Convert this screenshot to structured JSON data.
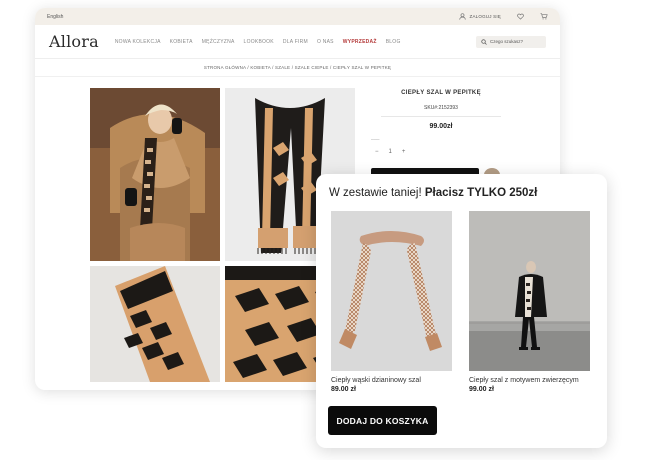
{
  "shop": {
    "topbar": {
      "language": "English",
      "login": "ZALOGUJ SIĘ"
    },
    "logo": "Allora",
    "nav": [
      {
        "label": "NOWA KOLEKCJA"
      },
      {
        "label": "KOBIETA"
      },
      {
        "label": "MĘŻCZYZNA"
      },
      {
        "label": "LOOKBOOK"
      },
      {
        "label": "DLA FIRM"
      },
      {
        "label": "O NAS"
      },
      {
        "label": "WYPRZEDAŻ"
      },
      {
        "label": "BLOG"
      }
    ],
    "search_placeholder": "Czego szukasz?",
    "breadcrumb": "STRONA GŁÓWNA / KOBIETA / SZALE / SZALE CIEPŁE / CIEPŁY SZAL W PEPITKĘ",
    "product": {
      "title": "CIEPŁY SZAL W PEPITKĘ",
      "sku": "SKU#:2152393",
      "price": "99.00zł",
      "quantity": "1",
      "minus": "−",
      "plus": "+"
    },
    "icons": {
      "user": "user-icon",
      "heart": "heart-icon",
      "cart": "cart-icon",
      "search": "search-icon"
    },
    "colors": {
      "sale": "#b43a3a",
      "topbar_bg": "#f3efe9",
      "accent_brown": "#b39d86"
    }
  },
  "bundle": {
    "title_prefix": "W zestawie taniej!",
    "title_bold": "Płacisz TYLKO 250zł",
    "items": [
      {
        "name": "Ciepły wąski dzianinowy szal",
        "price": "89.00 zł"
      },
      {
        "name": "Ciepły szal z motywem zwierzęcym",
        "price": "99.00 zł"
      }
    ],
    "button_label": "DODAJ DO KOSZYKA"
  }
}
